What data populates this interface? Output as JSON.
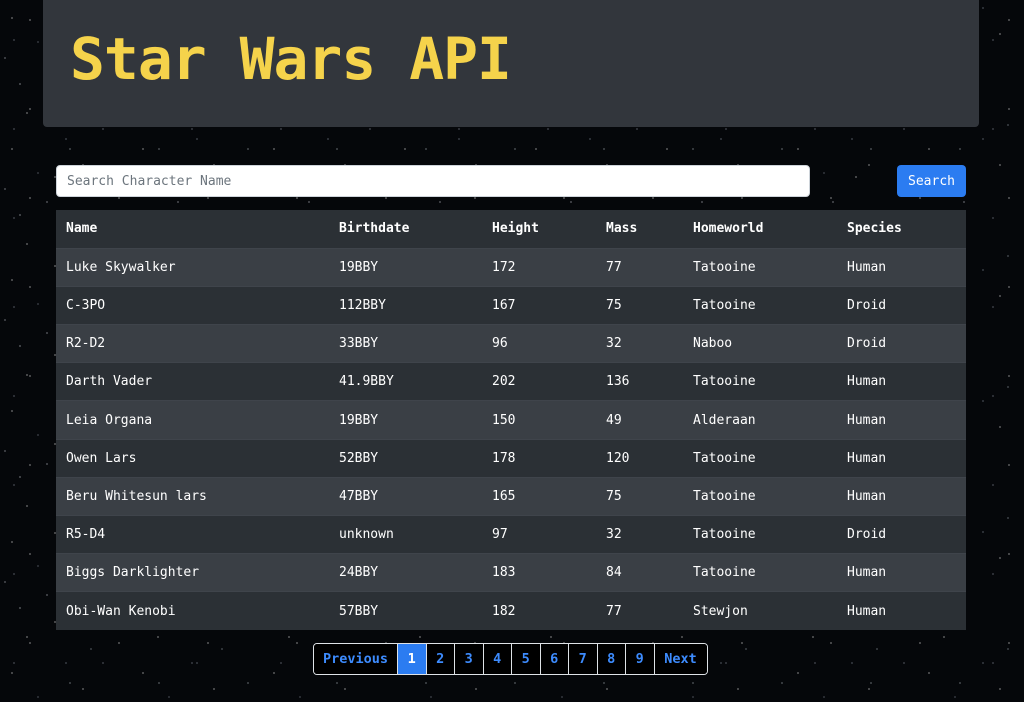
{
  "header": {
    "title": "Star Wars API"
  },
  "search": {
    "placeholder": "Search Character Name",
    "value": "",
    "button_label": "Search"
  },
  "table": {
    "columns": [
      "Name",
      "Birthdate",
      "Height",
      "Mass",
      "Homeworld",
      "Species"
    ],
    "rows": [
      [
        "Luke Skywalker",
        "19BBY",
        "172",
        "77",
        "Tatooine",
        "Human"
      ],
      [
        "C-3PO",
        "112BBY",
        "167",
        "75",
        "Tatooine",
        "Droid"
      ],
      [
        "R2-D2",
        "33BBY",
        "96",
        "32",
        "Naboo",
        "Droid"
      ],
      [
        "Darth Vader",
        "41.9BBY",
        "202",
        "136",
        "Tatooine",
        "Human"
      ],
      [
        "Leia Organa",
        "19BBY",
        "150",
        "49",
        "Alderaan",
        "Human"
      ],
      [
        "Owen Lars",
        "52BBY",
        "178",
        "120",
        "Tatooine",
        "Human"
      ],
      [
        "Beru Whitesun lars",
        "47BBY",
        "165",
        "75",
        "Tatooine",
        "Human"
      ],
      [
        "R5-D4",
        "unknown",
        "97",
        "32",
        "Tatooine",
        "Droid"
      ],
      [
        "Biggs Darklighter",
        "24BBY",
        "183",
        "84",
        "Tatooine",
        "Human"
      ],
      [
        "Obi-Wan Kenobi",
        "57BBY",
        "182",
        "77",
        "Stewjon",
        "Human"
      ]
    ]
  },
  "pagination": {
    "previous_label": "Previous",
    "next_label": "Next",
    "pages": [
      "1",
      "2",
      "3",
      "4",
      "5",
      "6",
      "7",
      "8",
      "9"
    ],
    "active_page": "1"
  },
  "colors": {
    "title": "#f5d34b",
    "header_bg": "#32363c",
    "accent": "#2b7cf1",
    "row_light": "#3a3f45",
    "row_dark": "#2b3035"
  }
}
